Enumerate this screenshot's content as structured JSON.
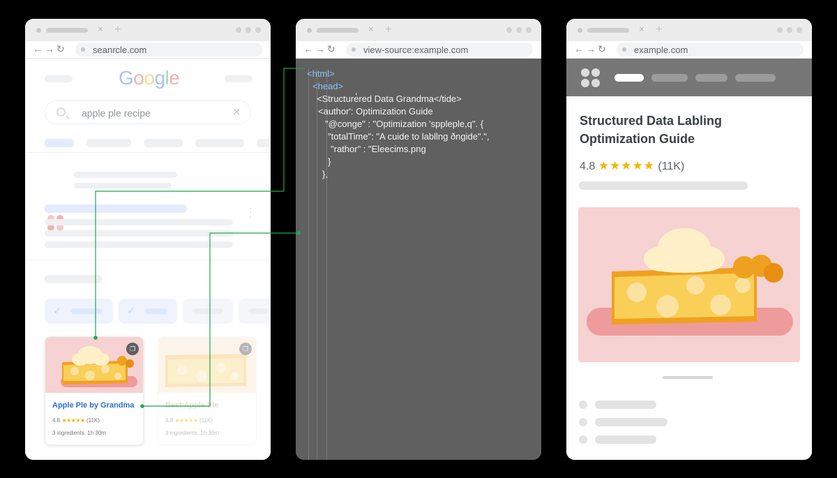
{
  "colors": {
    "background": "#000000",
    "google_blue": "#2f6fce",
    "star": "#f4b400",
    "connector": "#21a553",
    "code_panel": "#606060",
    "tag": "#8ec0ff",
    "pie_crust": "#f0a020",
    "pie_filling": "#f9cf58",
    "pie_cream": "#fff0c8",
    "hero_bg": "#f6d2d2"
  },
  "icons": {
    "back": "←",
    "forward": "→",
    "reload": "↻",
    "close": "×",
    "new_tab": "+",
    "star": "★",
    "bookmark": "bookmark-icon",
    "check": "✓"
  },
  "search_window": {
    "url": "seanrcle.com",
    "query": "apple ple recipe",
    "logo": {
      "letters": [
        "G",
        "o",
        "o",
        "g",
        "l",
        "e"
      ]
    },
    "cards": [
      {
        "title": "Apple Ple by Grandma",
        "rating": "4.8",
        "stars": "★★★★★",
        "count": "(11K)",
        "meta": "3 ingredients. 1h 30m"
      },
      {
        "title": "Best Apple Ple",
        "rating": "4.8",
        "stars": "★★★★★",
        "count": "(11K)",
        "meta": "3 ingredients. 1h 30m"
      }
    ]
  },
  "source_window": {
    "url": "view-source:example.com",
    "lines": [
      "<html>",
      "<head>",
      "<Structure̒red Data Grandma</tide>",
      "<author': Optimization Guide",
      "\"@conge\" : \"Optimization 'sppleple,q\". {",
      "\"totalTime\": \"A cuide to labllng ðngide\".\",",
      "\"rathor\" : \"Eleecims.png",
      "}",
      "},"
    ]
  },
  "article_window": {
    "url": "example.com",
    "title": "Structured Data Labling Optimization Guide",
    "rating": "4.8",
    "stars": "★★★★★",
    "count": "(11K)"
  }
}
